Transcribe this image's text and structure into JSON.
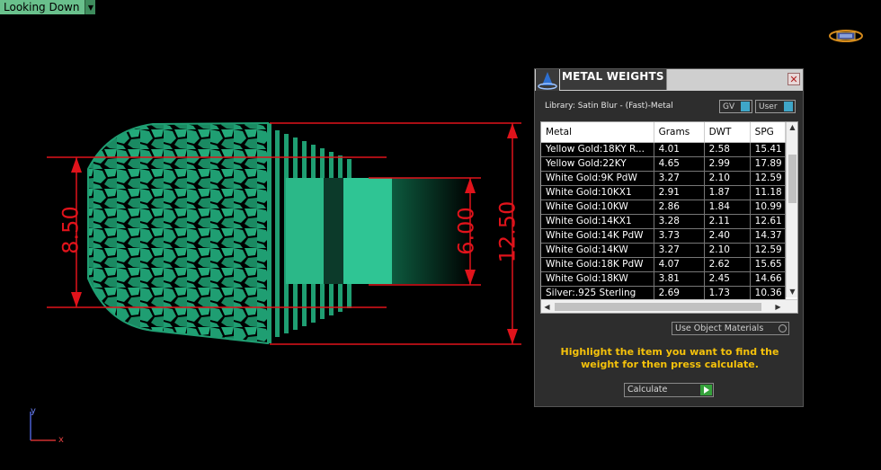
{
  "viewport": {
    "view_label": "Looking Down",
    "axis_y": "y",
    "axis_x": "x"
  },
  "dimensions": {
    "left_height": "8.50",
    "inner_height": "6.00",
    "outer_height": "12.50",
    "color": "#e0131b"
  },
  "panel": {
    "title": "METAL WEIGHTS",
    "library": "Library: Satin Blur - (Fast)-Metal",
    "toggle_gv": "GV",
    "toggle_user": "User",
    "columns": [
      "Metal",
      "Grams",
      "DWT",
      "SPG"
    ],
    "rows": [
      [
        "Yellow Gold:18KY R...",
        "4.01",
        "2.58",
        "15.41"
      ],
      [
        "Yellow Gold:22KY",
        "4.65",
        "2.99",
        "17.89"
      ],
      [
        "White Gold:9K PdW",
        "3.27",
        "2.10",
        "12.59"
      ],
      [
        "White Gold:10KX1",
        "2.91",
        "1.87",
        "11.18"
      ],
      [
        "White Gold:10KW",
        "2.86",
        "1.84",
        "10.99"
      ],
      [
        "White Gold:14KX1",
        "3.28",
        "2.11",
        "12.61"
      ],
      [
        "White Gold:14K PdW",
        "3.73",
        "2.40",
        "14.37"
      ],
      [
        "White Gold:14KW",
        "3.27",
        "2.10",
        "12.59"
      ],
      [
        "White Gold:18K PdW",
        "4.07",
        "2.62",
        "15.65"
      ],
      [
        "White Gold:18KW",
        "3.81",
        "2.45",
        "14.66"
      ],
      [
        "Silver:.925 Sterling",
        "2.69",
        "1.73",
        "10.36"
      ]
    ],
    "use_object_materials": "Use Object Materials",
    "instruction": "Highlight the item you want to find the weight for then press calculate.",
    "calculate_label": "Calculate"
  },
  "colors": {
    "ring_green": "#1f9e72",
    "instruction_yellow": "#f5c20b",
    "toggle_blue": "#3fa6c8",
    "go_green": "#35a13b"
  }
}
